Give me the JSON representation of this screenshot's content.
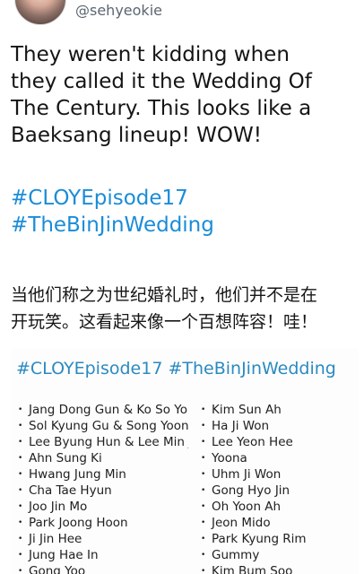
{
  "header": {
    "username": "@sehyeokie"
  },
  "tweet": {
    "lines": [
      "They weren't kidding when",
      "they called it the Wedding Of",
      "The Century. This looks like a",
      "Baeksang lineup! WOW!"
    ],
    "hashtags": [
      "#CLOYEpisode17",
      "#TheBinJinWedding"
    ],
    "chinese_lines": [
      "当他们称之为世纪婚礼时，他们并不是在",
      "开玩笑。这看起来像一个百想阵容！哇！"
    ]
  },
  "image": {
    "hashtags": "#CLOYEpisode17 #TheBinJinWedding",
    "left_names": [
      "Jang Dong Gun & Ko So Young",
      "Sol Kyung Gu & Song Yoon Ah",
      "Lee Byung Hun & Lee Min Jung",
      "Ahn Sung Ki",
      "Hwang Jung Min",
      "Cha Tae Hyun",
      "Joo Jin Mo",
      "Park Joong Hoon",
      "Ji Jin Hee",
      "Jung Hae In",
      "Gong Yoo"
    ],
    "right_names": [
      "Kim Sun Ah",
      "Ha Ji Won",
      "Lee Yeon Hee",
      "Yoona",
      "Uhm Ji Won",
      "Gong Hyo Jin",
      "Oh Yoon Ah",
      "Jeon Mido",
      "Park Kyung Rim",
      "Gummy",
      "Kim Bum Soo"
    ]
  },
  "colors": {
    "hashtag": "#1a8cd8",
    "image_hashtag": "#2b8ac0",
    "text": "#151515",
    "username": "#5b6670"
  }
}
